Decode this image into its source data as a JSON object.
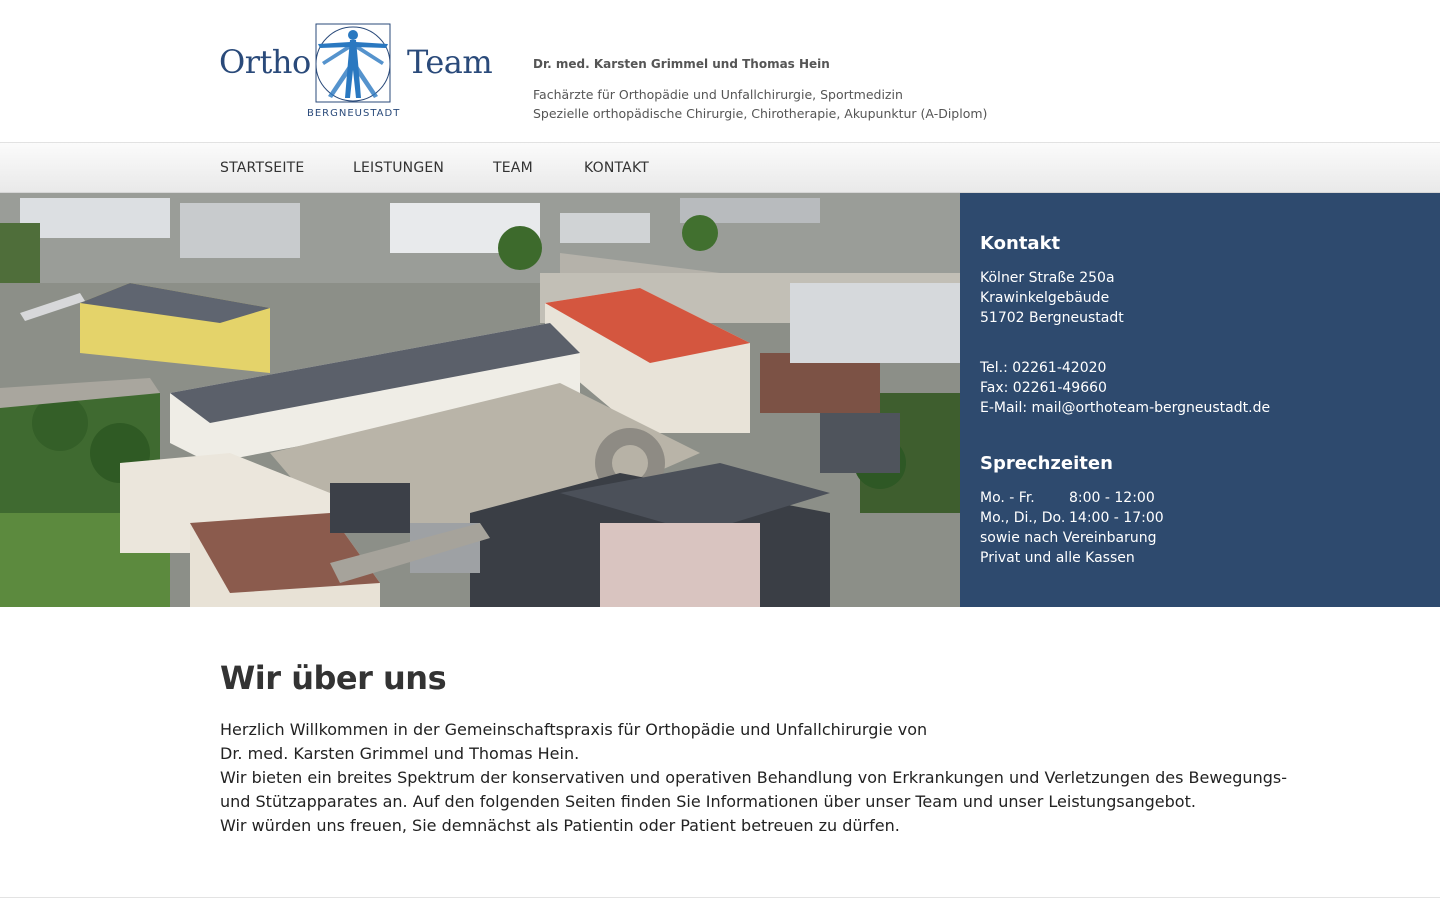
{
  "logo": {
    "word_left": "Ortho",
    "word_right": "Team",
    "subtitle": "BERGNEUSTADT",
    "icon": "vitruvian-man-icon"
  },
  "header": {
    "doctors": "Dr. med. Karsten Grimmel und Thomas Hein",
    "specialties_line1": "Fachärzte für Orthopädie und Unfallchirurgie, Sportmedizin",
    "specialties_line2": "Spezielle orthopädische Chirurgie, Chirotherapie, Akupunktur (A-Diplom)"
  },
  "nav": {
    "items": [
      {
        "label": "STARTSEITE"
      },
      {
        "label": "LEISTUNGEN"
      },
      {
        "label": "TEAM"
      },
      {
        "label": "KONTAKT"
      }
    ]
  },
  "contact": {
    "title": "Kontakt",
    "street": "Kölner Straße 250a",
    "building": "Krawinkelgebäude",
    "city": "51702 Bergneustadt",
    "tel": "Tel.: 02261-42020",
    "fax": "Fax: 02261-49660",
    "email": "E-Mail: mail@orthoteam-bergneustadt.de",
    "hours_title": "Sprechzeiten",
    "hours": [
      {
        "days": "Mo. - Fr.",
        "time": "8:00 - 12:00"
      },
      {
        "days": "Mo., Di., Do.",
        "time": "14:00 - 17:00"
      }
    ],
    "hours_note1": "sowie nach Vereinbarung",
    "hours_note2": "Privat und alle Kassen"
  },
  "main": {
    "heading": "Wir über uns",
    "lines": [
      "Herzlich Willkommen in der Gemeinschaftspraxis für Orthopädie und Unfallchirurgie von",
      "Dr. med. Karsten Grimmel und Thomas Hein.",
      "Wir bieten ein breites Spektrum der konservativen und operativen Behandlung von Erkrankungen und Verletzungen des Bewegungs-",
      "und Stützapparates an. Auf den folgenden Seiten finden Sie Informationen über unser Team und unser Leistungsangebot.",
      "Wir würden uns freuen, Sie demnächst als Patientin oder Patient betreuen zu dürfen."
    ]
  },
  "colors": {
    "brand_blue": "#2a4a7a",
    "contact_panel": "#2e4a6e"
  }
}
